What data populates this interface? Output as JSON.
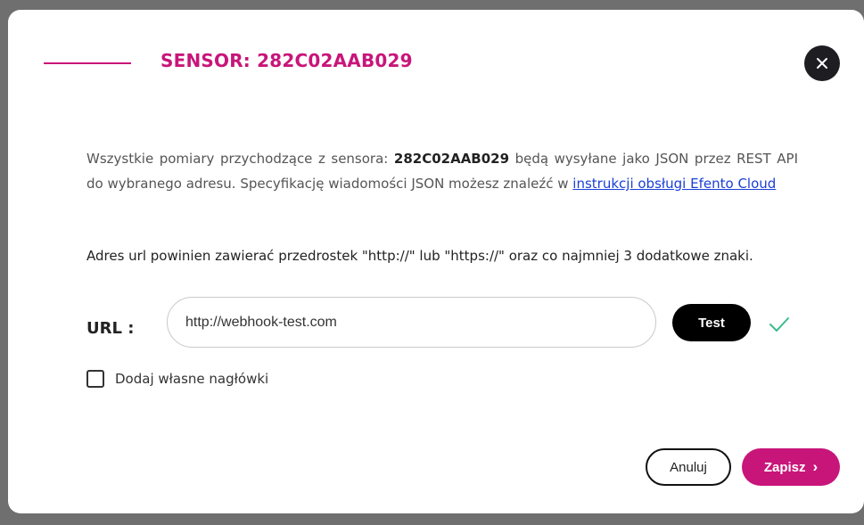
{
  "modal": {
    "title": "SENSOR: 282C02AAB029",
    "close_icon": "close-icon",
    "description": {
      "before": "Wszystkie pomiary przychodzące z sensora: ",
      "sensor_id": "282C02AAB029",
      "after": " będą wysyłane jako JSON przez REST API do wybranego adresu. Specyfikację wiadomości JSON możesz znaleźć w ",
      "link_text": "instrukcji obsługi Efento Cloud"
    },
    "note": "Adres url powinien zawierać przedrostek \"http://\" lub \"https://\" oraz co najmniej 3 dodatkowe znaki.",
    "url": {
      "label": "URL :",
      "value": "http://webhook-test.com",
      "test_label": "Test",
      "valid_icon": "check-icon"
    },
    "custom_headers": {
      "label": "Dodaj własne nagłówki",
      "checked": false
    },
    "actions": {
      "cancel_label": "Anuluj",
      "save_label": "Zapisz",
      "save_icon": "chevron-right-icon"
    }
  },
  "colors": {
    "accent": "#c8157a",
    "dark": "#1d1d22",
    "success": "#3dba8a",
    "link": "#1a3fd6",
    "backdrop": "#6f6f6f"
  }
}
